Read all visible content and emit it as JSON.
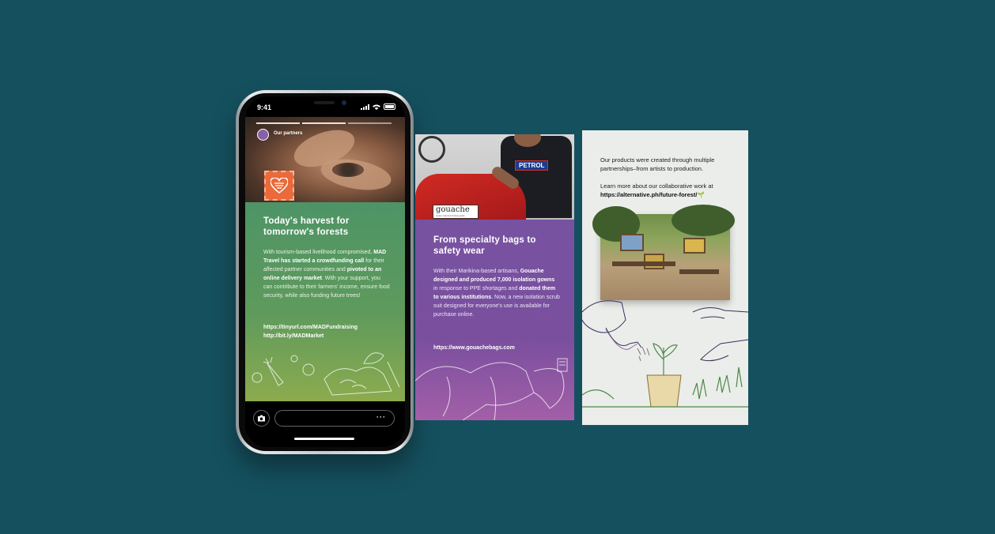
{
  "phone": {
    "status_time": "9:41",
    "signal_icon": "signal-bars-icon",
    "wifi_icon": "wifi-icon",
    "battery_icon": "battery-icon"
  },
  "story": {
    "account_name": "Our partners",
    "title": "Today's harvest for tomorrow's forests",
    "body_parts": [
      {
        "text": "With tourism-based livelihood compromised, ",
        "bold": false
      },
      {
        "text": "MAD Travel has started a crowdfunding call",
        "bold": true
      },
      {
        "text": " for their affected partner communities and ",
        "bold": false
      },
      {
        "text": "pivoted to an online delivery market",
        "bold": true
      },
      {
        "text": ". With your support, you can contribute to their farmers' income, ensure food security, while also funding future trees!",
        "bold": false
      }
    ],
    "links": [
      "https://tinyurl.com/MADFundraising",
      "http://bit.ly/MADMarket"
    ],
    "more_label": "···"
  },
  "gouache": {
    "logo_text": "gouache",
    "logo_tagline": "modern natural & furniture goods",
    "shirt_text": "PETROL",
    "title": "From specialty bags to safety wear",
    "body_parts": [
      {
        "text": "With their Marikina-based artisans, ",
        "bold": false
      },
      {
        "text": "Gouache designed and produced 7,000 isolation gowns",
        "bold": true
      },
      {
        "text": " in response to PPE shortages and ",
        "bold": false
      },
      {
        "text": "donated them to various institutions",
        "bold": true
      },
      {
        "text": ". Now, a new isolation scrub suit designed for everyone's use is available for purchase online.",
        "bold": false
      }
    ],
    "link": "https://www.gouachebags.com"
  },
  "forest": {
    "intro": "Our products were created through multiple partnerships–from artists to production.",
    "learn_more": "Learn more about our collaborative work at",
    "link": "https://alternative.ph/future-forest/",
    "sprout_emoji": "🌱"
  },
  "colors": {
    "background": "#15505e",
    "story_green": "#5e9a5c",
    "gouache_purple": "#7752a1",
    "forest_card": "#ebedea",
    "badge_orange": "#ea6a3b"
  }
}
